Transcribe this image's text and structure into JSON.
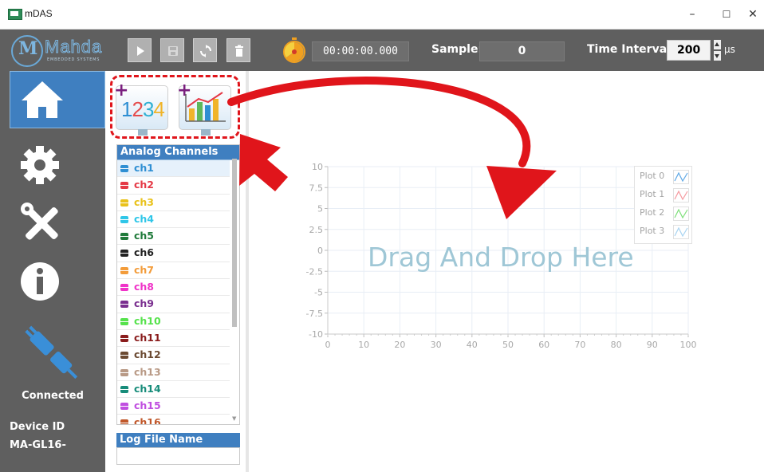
{
  "window": {
    "title": "mDAS",
    "minimize": "–",
    "maximize": "☐",
    "close": "✕"
  },
  "logo": {
    "brand": "Mahda",
    "subtitle": "EMBEDDED SYSTEMS"
  },
  "toolbar": {
    "buttons": [
      "play",
      "save",
      "refresh",
      "delete"
    ],
    "time": "00:00:00.000",
    "sample_label": "Sample:",
    "sample_value": "0",
    "time_interval_label": "Time Interval:",
    "time_interval_value": "200",
    "time_interval_unit": "µs"
  },
  "nav": {
    "items": [
      "home",
      "settings",
      "tools",
      "info"
    ],
    "active": "home",
    "status": "Connected",
    "device_id_label": "Device ID",
    "device_id_value": "MA-GL16-"
  },
  "widgets": {
    "numeric_text": "1234"
  },
  "channels": {
    "header": "Analog Channels",
    "selected": "ch1",
    "items": [
      {
        "label": "ch1",
        "color": "#2f8fd3"
      },
      {
        "label": "ch2",
        "color": "#e53946"
      },
      {
        "label": "ch3",
        "color": "#e9c21c"
      },
      {
        "label": "ch4",
        "color": "#2fc6e8"
      },
      {
        "label": "ch5",
        "color": "#1f7a3a"
      },
      {
        "label": "ch6",
        "color": "#222222"
      },
      {
        "label": "ch7",
        "color": "#f39c3a"
      },
      {
        "label": "ch8",
        "color": "#f032c8"
      },
      {
        "label": "ch9",
        "color": "#7a2f8f"
      },
      {
        "label": "ch10",
        "color": "#56e24c"
      },
      {
        "label": "ch11",
        "color": "#8a1c1c"
      },
      {
        "label": "ch12",
        "color": "#6b4a32"
      },
      {
        "label": "ch13",
        "color": "#b99a86"
      },
      {
        "label": "ch14",
        "color": "#178c7a"
      },
      {
        "label": "ch15",
        "color": "#c04fe0"
      },
      {
        "label": "ch16",
        "color": "#c0572a"
      }
    ]
  },
  "log": {
    "header": "Log File Name",
    "value": ""
  },
  "plot": {
    "placeholder": "Drag And Drop Here",
    "legend": [
      {
        "name": "Plot 0",
        "color": "#5fa8e6"
      },
      {
        "name": "Plot 1",
        "color": "#f59aa0"
      },
      {
        "name": "Plot 2",
        "color": "#7ee07a"
      },
      {
        "name": "Plot 3",
        "color": "#a8d4f2"
      }
    ],
    "y_ticks": [
      "10",
      "7.5",
      "5",
      "2.5",
      "0",
      "-2.5",
      "-5",
      "-7.5",
      "-10"
    ],
    "x_ticks": [
      "0",
      "10",
      "20",
      "30",
      "40",
      "50",
      "60",
      "70",
      "80",
      "90",
      "100"
    ],
    "grid_color": "#e8eef6"
  }
}
